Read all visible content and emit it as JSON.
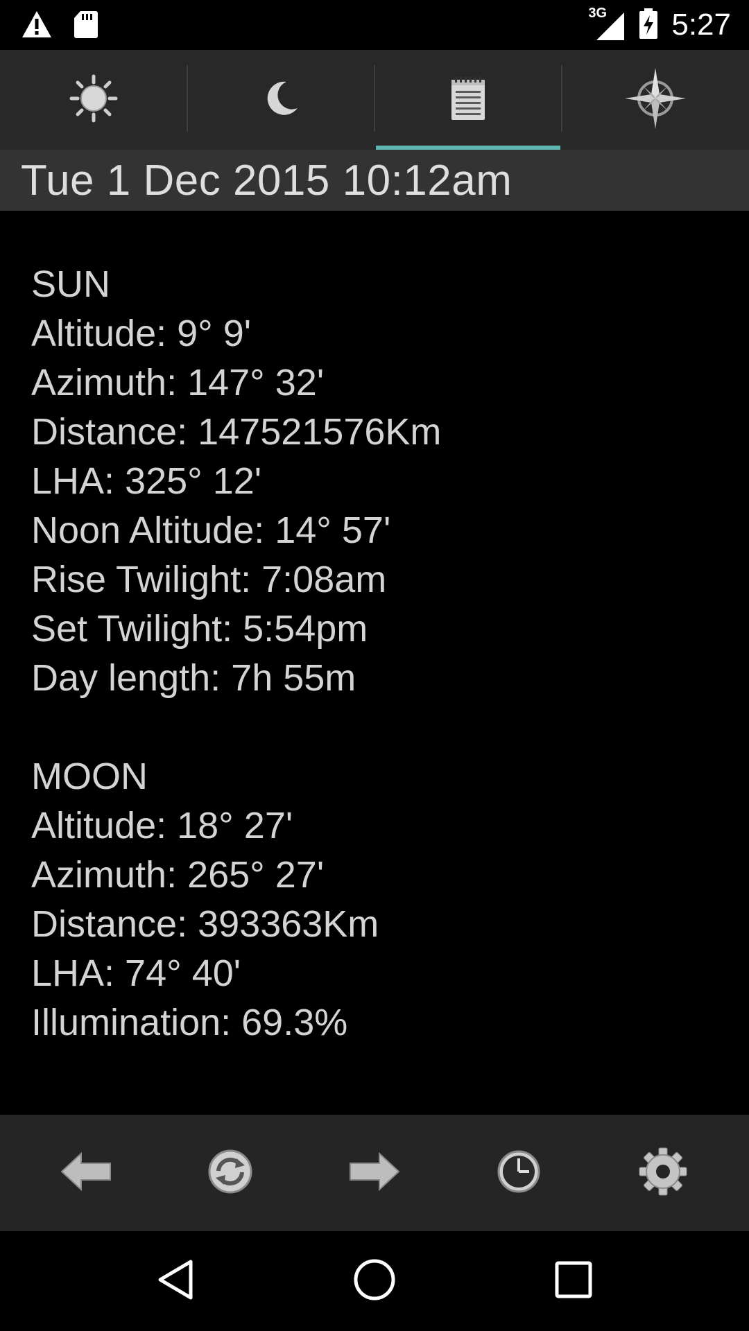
{
  "status_bar": {
    "network": "3G",
    "time": "5:27",
    "icons": [
      "warning-icon",
      "sd-card-icon",
      "signal-icon",
      "battery-charging-icon"
    ]
  },
  "tabs": [
    {
      "name": "sun",
      "icon": "sun-icon",
      "active": false
    },
    {
      "name": "moon",
      "icon": "moon-icon",
      "active": false
    },
    {
      "name": "notes",
      "icon": "notepad-icon",
      "active": true
    },
    {
      "name": "compass",
      "icon": "compass-icon",
      "active": false
    }
  ],
  "date_header": "Tue 1 Dec 2015 10:12am",
  "sun": {
    "title": "SUN",
    "lines": [
      "Altitude: 9° 9'",
      "Azimuth: 147° 32'",
      "Distance: 147521576Km",
      "LHA: 325° 12'",
      "Noon Altitude: 14° 57'",
      "Rise Twilight: 7:08am",
      "Set Twilight: 5:54pm",
      "Day length: 7h 55m"
    ]
  },
  "moon": {
    "title": "MOON",
    "lines": [
      "Altitude: 18° 27'",
      "Azimuth: 265° 27'",
      "Distance: 393363Km",
      "LHA: 74° 40'",
      "Illumination: 69.3%"
    ]
  },
  "toolbar": [
    "arrow-left-icon",
    "refresh-icon",
    "arrow-right-icon",
    "clock-icon",
    "gear-icon"
  ],
  "nav_bar": [
    "back-icon",
    "home-icon",
    "recents-icon"
  ],
  "colors": {
    "tab_indicator": "#5fb6b0",
    "tab_bar": "#282828",
    "date_header": "#333333",
    "toolbar": "#252525",
    "text": "#d4d4d4"
  }
}
